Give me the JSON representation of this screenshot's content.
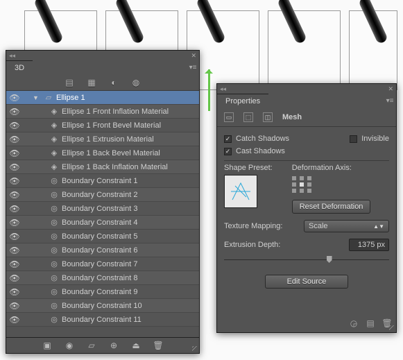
{
  "panel3d": {
    "title": "3D",
    "tool_icons": [
      "layers-icon",
      "trash-icon",
      "sphere-icon",
      "light-icon"
    ],
    "layers": [
      {
        "twisty": "▼",
        "icon": "plane",
        "label": "Ellipse 1",
        "selected": true,
        "indent": 0
      },
      {
        "icon": "material",
        "label": "Ellipse 1 Front Inflation Material",
        "indent": 1
      },
      {
        "icon": "material",
        "label": "Ellipse 1 Front Bevel Material",
        "indent": 1
      },
      {
        "icon": "material",
        "label": "Ellipse 1 Extrusion Material",
        "indent": 1
      },
      {
        "icon": "material",
        "label": "Ellipse 1 Back Bevel Material",
        "indent": 1
      },
      {
        "icon": "material",
        "label": "Ellipse 1 Back Inflation Material",
        "indent": 1
      },
      {
        "icon": "constraint",
        "label": "Boundary Constraint 1",
        "indent": 1
      },
      {
        "icon": "constraint",
        "label": "Boundary Constraint 2",
        "indent": 1
      },
      {
        "icon": "constraint",
        "label": "Boundary Constraint 3",
        "indent": 1
      },
      {
        "icon": "constraint",
        "label": "Boundary Constraint 4",
        "indent": 1
      },
      {
        "icon": "constraint",
        "label": "Boundary Constraint 5",
        "indent": 1
      },
      {
        "icon": "constraint",
        "label": "Boundary Constraint 6",
        "indent": 1
      },
      {
        "icon": "constraint",
        "label": "Boundary Constraint 7",
        "indent": 1
      },
      {
        "icon": "constraint",
        "label": "Boundary Constraint 8",
        "indent": 1
      },
      {
        "icon": "constraint",
        "label": "Boundary Constraint 9",
        "indent": 1
      },
      {
        "icon": "constraint",
        "label": "Boundary Constraint 10",
        "indent": 1
      },
      {
        "icon": "constraint",
        "label": "Boundary Constraint 11",
        "indent": 1
      }
    ],
    "bottom_icons": [
      "new-icon",
      "lightbulb-icon",
      "dropdown-icon",
      "target-icon",
      "ground-icon",
      "trash-icon"
    ]
  },
  "props": {
    "title": "Properties",
    "mesh_label": "Mesh",
    "catch_shadows": "Catch Shadows",
    "cast_shadows": "Cast Shadows",
    "invisible": "Invisible",
    "shape_preset": "Shape Preset:",
    "deformation_axis": "Deformation Axis:",
    "reset_deformation": "Reset Deformation",
    "texture_mapping": "Texture Mapping:",
    "texture_mapping_value": "Scale",
    "extrusion_depth": "Extrusion Depth:",
    "extrusion_depth_value": "1375 px",
    "edit_source": "Edit Source",
    "corner_icons": [
      "render-icon",
      "document-icon",
      "trash-icon"
    ]
  }
}
